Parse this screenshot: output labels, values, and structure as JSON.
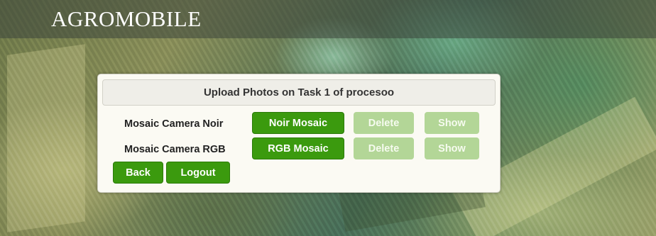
{
  "app": {
    "brand": "AGROMOBILE"
  },
  "panel": {
    "title": "Upload Photos on Task 1 of procesoo",
    "rows": [
      {
        "label": "Mosaic Camera Noir",
        "mosaic_button": "Noir Mosaic",
        "delete_button": "Delete",
        "show_button": "Show"
      },
      {
        "label": "Mosaic Camera RGB",
        "mosaic_button": "RGB Mosaic",
        "delete_button": "Delete",
        "show_button": "Show"
      }
    ],
    "back_button": "Back",
    "logout_button": "Logout"
  },
  "colors": {
    "primary_button": "#3b9a0e",
    "disabled_button": "#b3d697",
    "panel_background": "#fbfaf3"
  }
}
